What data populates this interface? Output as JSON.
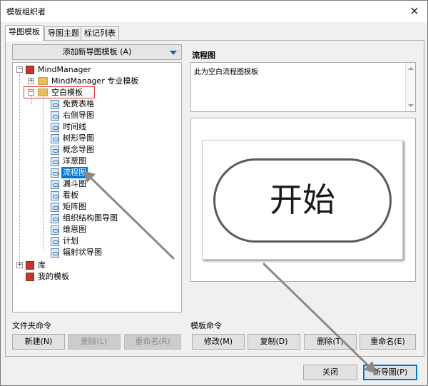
{
  "window": {
    "title": "模板组织者",
    "close_glyph": "✕"
  },
  "tabs": [
    {
      "label": "导图模板",
      "active": true
    },
    {
      "label": "导图主题",
      "active": false
    },
    {
      "label": "标记列表",
      "active": false
    }
  ],
  "left": {
    "add_template_label": "添加新导图模板 (A)",
    "tree": {
      "root": "MindManager",
      "pro_templates": "MindManager 专业模板",
      "blank_templates": "空白模板",
      "items": [
        "免费表格",
        "右侧导图",
        "时间线",
        "树形导图",
        "概念导图",
        "洋葱图",
        "流程图",
        "漏斗图",
        "看板",
        "矩阵图",
        "组织结构图导图",
        "维恩图",
        "计划",
        "辐射状导图"
      ],
      "selected": "流程图",
      "library": "库",
      "my_templates": "我的模板"
    },
    "folder_commands_label": "文件夹命令",
    "folder_buttons": {
      "new": "新建(N)",
      "delete": "删除(L)",
      "rename": "重命名(R)"
    }
  },
  "right": {
    "title": "流程图",
    "description": "此为空白流程图模板",
    "preview_text": "开始",
    "template_commands_label": "模板命令",
    "template_buttons": {
      "modify": "修改(M)",
      "copy": "复制(D)",
      "delete": "删除(T)",
      "rename": "重命名(E)"
    }
  },
  "footer": {
    "close": "关闭",
    "new_map": "新导图(P)"
  },
  "colors": {
    "accent": "#0078d7",
    "annotation_red": "#e03c3c",
    "arrow_gray": "#8a8a8a"
  }
}
